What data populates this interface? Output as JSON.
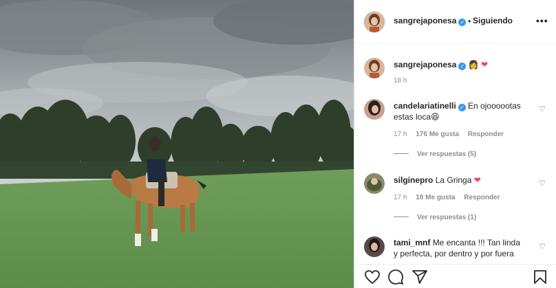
{
  "post": {
    "author": "sangrejaponesa",
    "follow_dot": "•",
    "follow_label": "Siguiendo",
    "more_label": "•••"
  },
  "caption": {
    "username": "sangrejaponesa",
    "emoji_woman": "👩",
    "emoji_heart": "❤",
    "time": "18 h"
  },
  "comments": [
    {
      "username": "candelariatinelli",
      "verified": true,
      "text_line1": "En ojoooootas",
      "text_line2": "estas loca",
      "emoji": "😆",
      "time": "17 h",
      "likes": "176 Me gusta",
      "reply": "Responder",
      "view_replies": "Ver respuestas (5)"
    },
    {
      "username": "silginepro",
      "text": "La Gringa",
      "emoji": "❤",
      "time": "17 h",
      "likes": "18 Me gusta",
      "reply": "Responder",
      "view_replies": "Ver respuestas (1)"
    },
    {
      "username": "tami_mnf",
      "text_line1": "Me encanta !!! Tan linda",
      "text_line2": "y perfecta, por dentro y por fuera"
    }
  ],
  "icons": {
    "verified": "✓",
    "comment_like": "♡"
  },
  "colors": {
    "verified_blue": "#3897f0",
    "heart_red": "#ed4956",
    "secondary_text": "#8e8e8e"
  }
}
